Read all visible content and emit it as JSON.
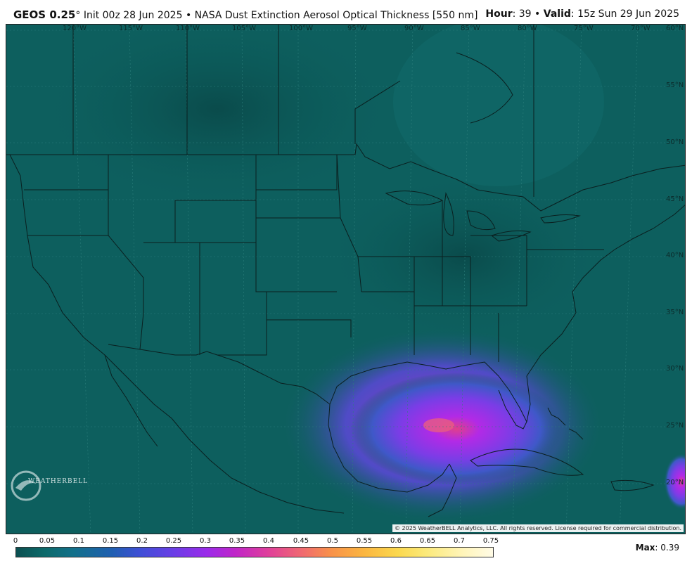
{
  "header": {
    "model": "GEOS 0.25",
    "degree": "°",
    "init": "Init 00z 28 Jun 2025",
    "separator": "•",
    "product": "NASA Dust Extinction Aerosol Optical Thickness [550 nm]",
    "hour_label": "Hour",
    "hour_value": ": 39",
    "valid_label": "Valid",
    "valid_value": ": 15z Sun 29 Jun 2025"
  },
  "map": {
    "lon_labels": [
      "120°W",
      "115°W",
      "110°W",
      "105°W",
      "100°W",
      "95°W",
      "90°W",
      "85°W",
      "80°W",
      "75°W",
      "70°W"
    ],
    "lat_labels": [
      "60°N",
      "55°N",
      "50°N",
      "45°N",
      "40°N",
      "35°N",
      "30°N",
      "25°N",
      "20°N"
    ],
    "copyright": "© 2025 WeatherBELL Analytics, LLC. All rights reserved. License required for commercial distribution.",
    "logo_text": "WEATHERBELL"
  },
  "legend": {
    "ticks": [
      "0",
      "0.05",
      "0.1",
      "0.15",
      "0.2",
      "0.25",
      "0.3",
      "0.35",
      "0.4",
      "0.45",
      "0.5",
      "0.55",
      "0.6",
      "0.65",
      "0.7",
      "0.75"
    ],
    "max_label": "Max",
    "max_value": ": 0.39"
  },
  "colors": {
    "background_field": "#0d5f5e",
    "dust_plume": "#a22be6",
    "border_lines": "#0a1f1f"
  }
}
